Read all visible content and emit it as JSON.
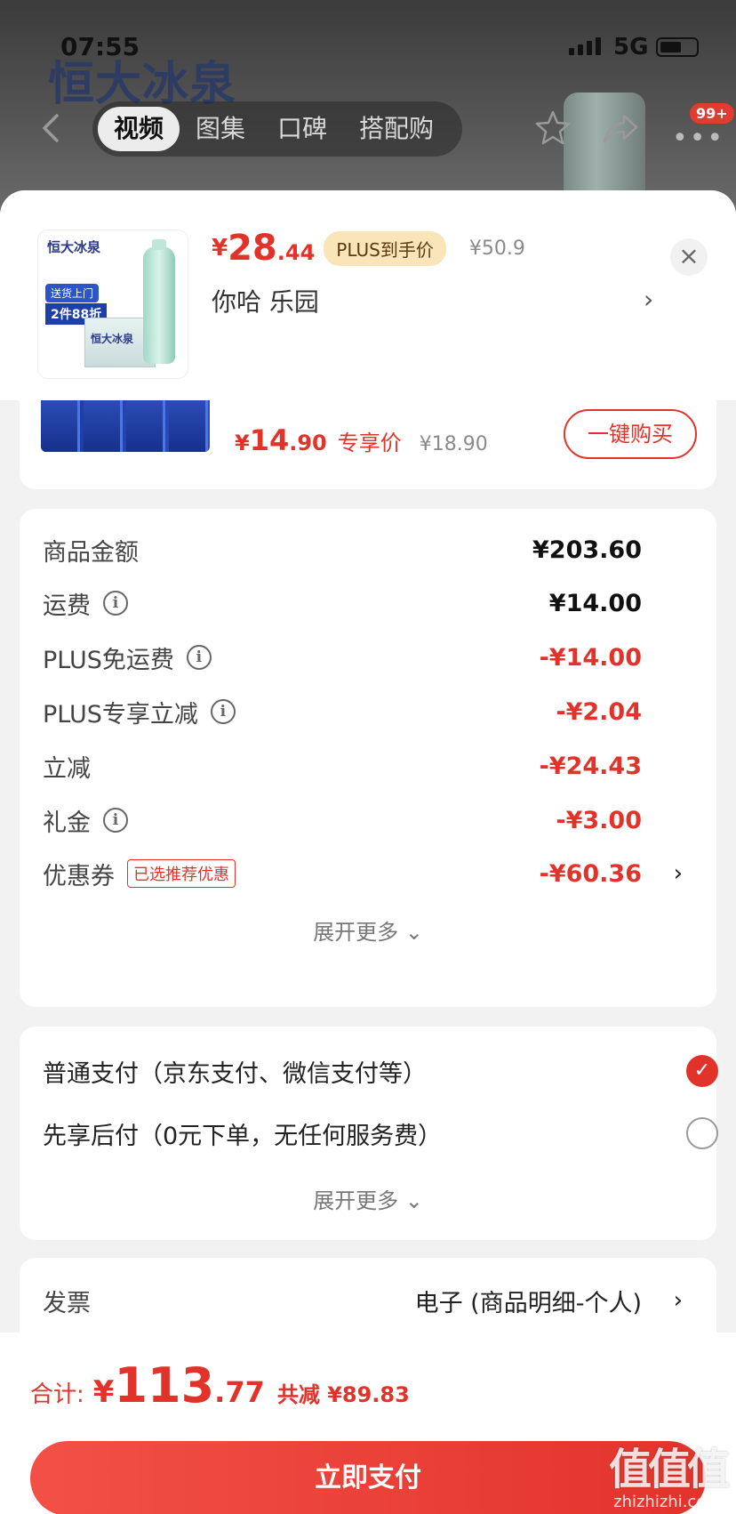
{
  "status_bar": {
    "time": "07:55",
    "network": "5G"
  },
  "background_page": {
    "brand_logo": "恒大冰泉",
    "tabs": [
      {
        "label": "视频",
        "active": true
      },
      {
        "label": "图集",
        "active": false
      },
      {
        "label": "口碑",
        "active": false
      },
      {
        "label": "搭配购",
        "active": false
      }
    ],
    "cart_badge": "99+"
  },
  "product_header": {
    "price_symbol": "¥",
    "price_int": "28",
    "price_dec": ".44",
    "plus_tag": "PLUS到手价",
    "original_price": "¥50.9",
    "address": "你哈  乐园",
    "thumb_logo": "恒大冰泉",
    "thumb_promo1": "送货上门",
    "thumb_promo2": "2件88折",
    "thumb_box": "恒大冰泉"
  },
  "bundle": {
    "price_symbol": "¥",
    "price_int": "14",
    "price_dec": ".90",
    "price_label": "专享价",
    "original_price": "¥18.90",
    "buy_label": "一键购买"
  },
  "summary": {
    "rows": [
      {
        "label": "商品金额",
        "value": "¥203.60",
        "info": false,
        "red": false
      },
      {
        "label": "运费",
        "value": "¥14.00",
        "info": true,
        "red": false
      },
      {
        "label": "PLUS免运费",
        "value": "-¥14.00",
        "info": true,
        "red": true
      },
      {
        "label": "PLUS专享立减",
        "value": "-¥2.04",
        "info": true,
        "red": true
      },
      {
        "label": "立减",
        "value": "-¥24.43",
        "info": false,
        "red": true
      },
      {
        "label": "礼金",
        "value": "-¥3.00",
        "info": true,
        "red": true
      },
      {
        "label": "优惠券",
        "value": "-¥60.36",
        "info": false,
        "red": true,
        "tag": "已选推荐优惠"
      }
    ],
    "expand_label": "展开更多 ⌄"
  },
  "payment": {
    "options": [
      {
        "label": "普通支付（京东支付、微信支付等）",
        "selected": true
      },
      {
        "label": "先享后付（0元下单，无任何服务费）",
        "selected": false
      }
    ],
    "expand_label": "展开更多 ⌄"
  },
  "invoice": {
    "label": "发票",
    "value": "电子 (商品明细-个人)"
  },
  "bottom": {
    "total_label": "合计:",
    "total_symbol": "¥",
    "total_int": "113",
    "total_dec": ".77",
    "saving": "共减 ¥89.83",
    "pay_label": "立即支付"
  },
  "watermark": {
    "mark": "值值值",
    "text": "zhizhizhi.com"
  },
  "colors": {
    "accent": "#e2332b",
    "plus_tag_bg": "#f9e5b8"
  }
}
